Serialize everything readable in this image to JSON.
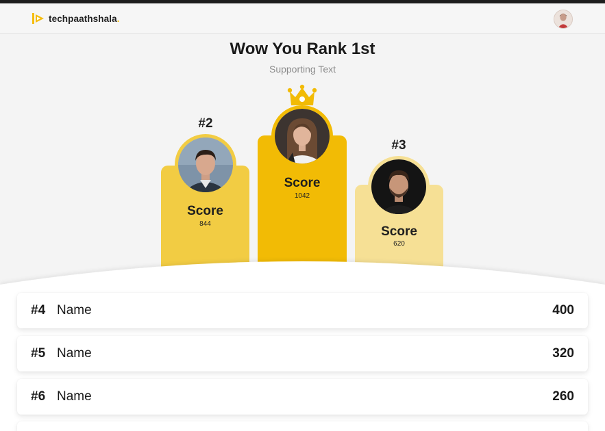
{
  "app": {
    "logo_text": "techpaathshala",
    "logo_dot": "."
  },
  "header": {
    "title": "Wow You Rank 1st",
    "subtitle": "Supporting Text"
  },
  "podium": {
    "first": {
      "rank": "#1",
      "score_label": "Score",
      "score": "1042"
    },
    "second": {
      "rank": "#2",
      "score_label": "Score",
      "score": "844"
    },
    "third": {
      "rank": "#3",
      "score_label": "Score",
      "score": "620"
    }
  },
  "leaderboard": [
    {
      "rank": "#4",
      "name": "Name",
      "score": "400"
    },
    {
      "rank": "#5",
      "name": "Name",
      "score": "320"
    },
    {
      "rank": "#6",
      "name": "Name",
      "score": "260"
    }
  ],
  "colors": {
    "brand_yellow": "#f5bd0f",
    "podium_first": "#f2bb05",
    "podium_second": "#f2cc43",
    "podium_third": "#f6e095",
    "page_bg": "#f4f4f4"
  },
  "icons": {
    "logo": "play-flag-icon",
    "crown": "crown-icon",
    "avatar": "user-avatar"
  }
}
